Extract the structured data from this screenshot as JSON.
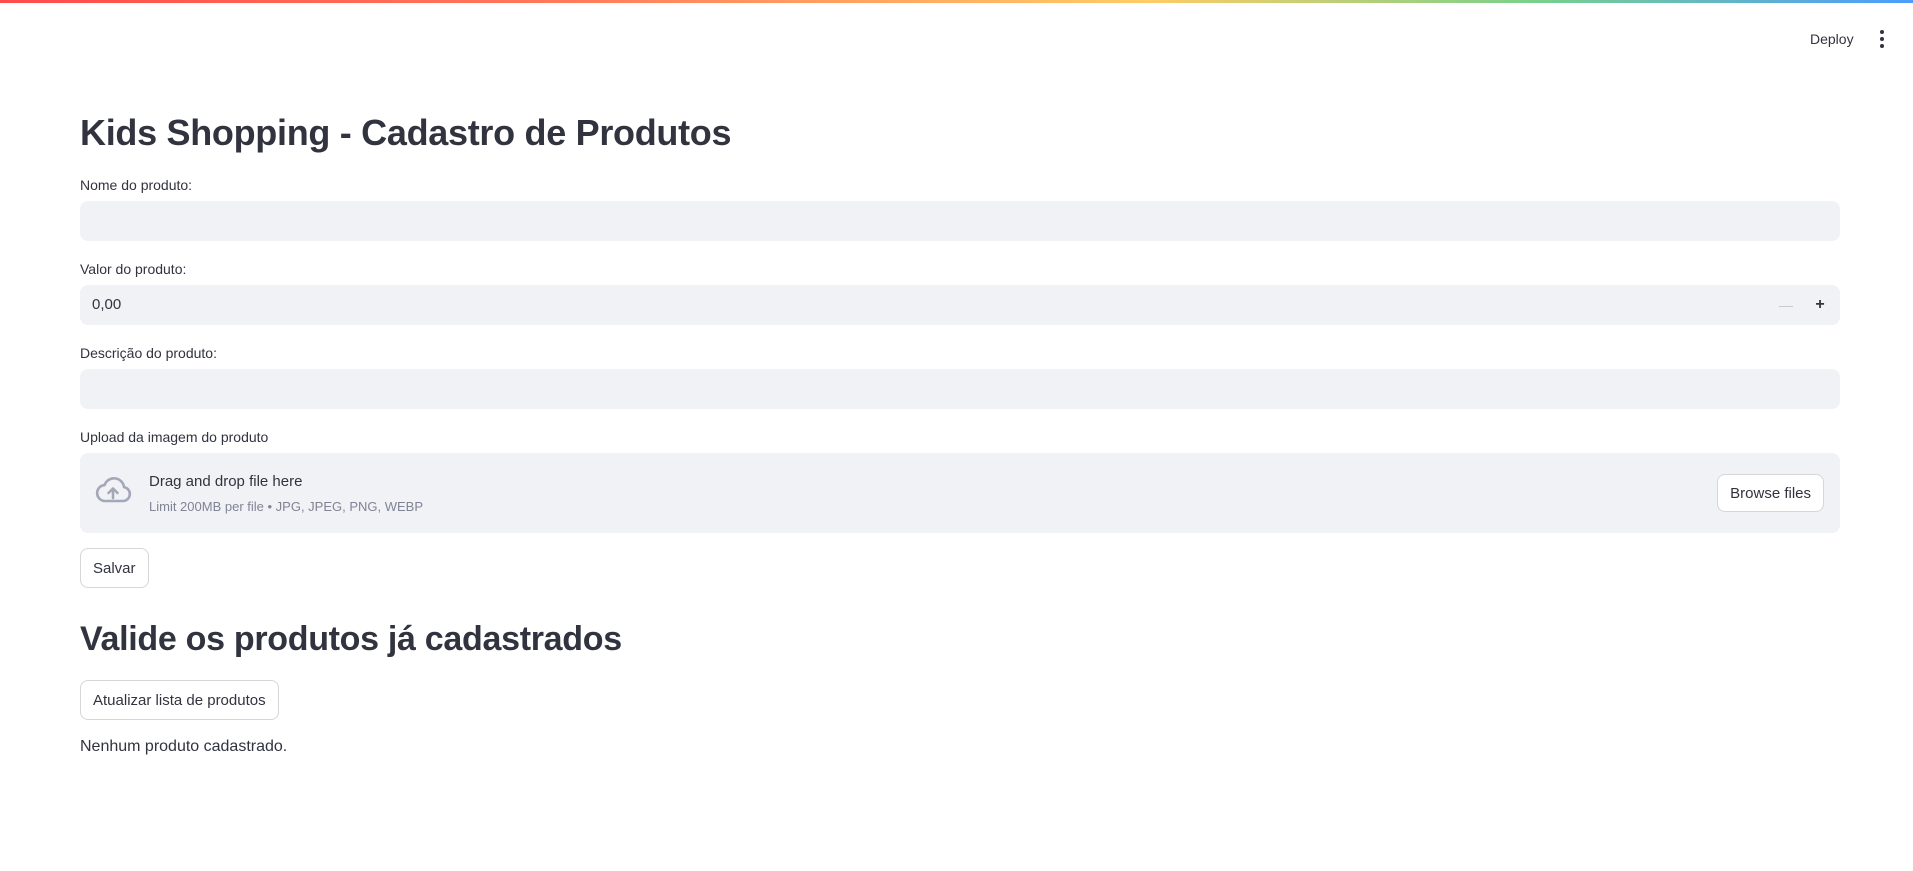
{
  "header": {
    "deploy_label": "Deploy",
    "menu_icon": "kebab-menu-icon"
  },
  "page": {
    "title": "Kids Shopping - Cadastro de Produtos"
  },
  "form": {
    "name_label": "Nome do produto:",
    "name_value": "",
    "price_label": "Valor do produto:",
    "price_value": "0,00",
    "price_minus_icon": "minus-icon",
    "price_plus_icon": "plus-icon",
    "description_label": "Descrição do produto:",
    "description_value": "",
    "upload_label": "Upload da imagem do produto",
    "upload": {
      "icon": "cloud-upload-icon",
      "title": "Drag and drop file here",
      "subtitle": "Limit 200MB per file • JPG, JPEG, PNG, WEBP",
      "browse_label": "Browse files"
    },
    "save_label": "Salvar"
  },
  "products_section": {
    "title": "Valide os produtos já cadastrados",
    "refresh_label": "Atualizar lista de produtos",
    "empty_message": "Nenhum produto cadastrado."
  },
  "colors": {
    "input_bg": "#f0f2f6",
    "text": "#31333f",
    "muted": "#808495",
    "border": "#d6d6d9"
  }
}
